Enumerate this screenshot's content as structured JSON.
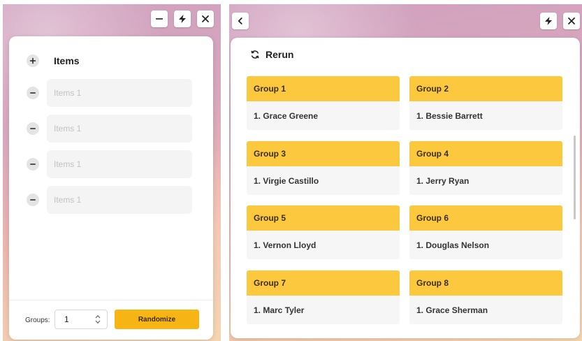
{
  "left_panel": {
    "window_controls": {
      "minimize_icon": "minus-icon",
      "snap_icon": "lightning-icon",
      "close_icon": "close-icon"
    },
    "items_title": "Items",
    "add_icon": "plus-icon",
    "remove_icon": "minus-icon",
    "items": [
      {
        "placeholder": "Items 1",
        "value": ""
      },
      {
        "placeholder": "Items 1",
        "value": ""
      },
      {
        "placeholder": "Items 1",
        "value": ""
      },
      {
        "placeholder": "Items 1",
        "value": ""
      }
    ],
    "footer": {
      "groups_label": "Groups:",
      "groups_value": "1",
      "randomize_label": "Randomize"
    }
  },
  "right_panel": {
    "window_controls": {
      "back_icon": "chevron-left-icon",
      "snap_icon": "lightning-icon",
      "close_icon": "close-icon"
    },
    "rerun_label": "Rerun",
    "rerun_icon": "refresh-icon",
    "groups": [
      {
        "title": "Group 1",
        "member": "1. Grace Greene"
      },
      {
        "title": "Group 2",
        "member": "1. Bessie Barrett"
      },
      {
        "title": "Group 3",
        "member": "1. Virgie Castillo"
      },
      {
        "title": "Group 4",
        "member": "1. Jerry Ryan"
      },
      {
        "title": "Group 5",
        "member": "1. Vernon Lloyd"
      },
      {
        "title": "Group 6",
        "member": "1. Douglas Nelson"
      },
      {
        "title": "Group 7",
        "member": "1. Marc Tyler"
      },
      {
        "title": "Group 8",
        "member": "1. Grace Sherman"
      }
    ]
  },
  "colors": {
    "accent": "#f6b514",
    "group_header": "#fcc93e"
  }
}
